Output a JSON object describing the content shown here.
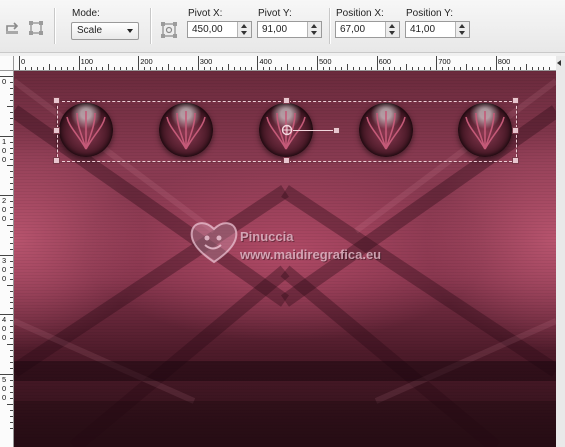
{
  "toolbar": {
    "mode_label": "Mode:",
    "mode_value": "Scale",
    "pivot_x_label": "Pivot X:",
    "pivot_x_value": "450,00",
    "pivot_y_label": "Pivot Y:",
    "pivot_y_value": "91,00",
    "position_x_label": "Position X:",
    "position_x_value": "67,00",
    "position_y_label": "Position Y:",
    "position_y_value": "41,00",
    "icons": [
      "reset-icon",
      "transform-icon",
      "pivot-icon"
    ]
  },
  "ruler_horizontal": [
    "0",
    "100",
    "200",
    "300",
    "400",
    "500",
    "600",
    "700",
    "800"
  ],
  "ruler_vertical": [
    "0",
    "1\n0\n0",
    "2\n0\n0",
    "3\n0\n0",
    "4\n0\n0",
    "5\n0\n0"
  ],
  "canvas": {
    "watermark_line1": "Pinuccia",
    "watermark_line2": "www.maidiregrafica.eu",
    "orb_count": 5
  },
  "colors": {
    "canvas_base": "#7f3249",
    "selection": "#f0d0d8",
    "toolbar_bg": "#f0f0f0"
  }
}
